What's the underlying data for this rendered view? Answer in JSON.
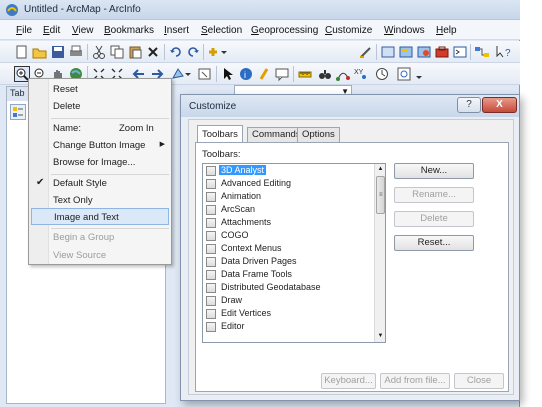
{
  "window": {
    "title": "Untitled - ArcMap - ArcInfo"
  },
  "menubar": {
    "items": [
      {
        "key": "F",
        "rest": "ile"
      },
      {
        "key": "E",
        "rest": "dit"
      },
      {
        "key": "V",
        "rest": "iew"
      },
      {
        "key": "B",
        "rest": "ookmarks"
      },
      {
        "key": "I",
        "rest": "nsert"
      },
      {
        "key": "S",
        "rest": "election"
      },
      {
        "key": "G",
        "rest": "eoprocessing"
      },
      {
        "key": "C",
        "rest": "ustomize"
      },
      {
        "key": "W",
        "rest": "indows"
      },
      {
        "key": "H",
        "rest": "elp"
      }
    ]
  },
  "toc": {
    "header": "Tab"
  },
  "context_menu": {
    "reset": "Reset",
    "delete": "Delete",
    "name_label": "Name:",
    "name_value": "Zoom In",
    "change_button_image": "Change Button Image",
    "browse_for_image": "Browse for Image...",
    "default_style": "Default Style",
    "text_only": "Text Only",
    "image_and_text": "Image and Text",
    "begin_a_group": "Begin a Group",
    "view_source": "View Source"
  },
  "dialog": {
    "title": "Customize",
    "help_glyph": "?",
    "close_glyph": "X",
    "tabs": [
      "Toolbars",
      "Commands",
      "Options"
    ],
    "toolbars_label": "Toolbars:",
    "toolbar_items": [
      "3D Analyst",
      "Advanced Editing",
      "Animation",
      "ArcScan",
      "Attachments",
      "COGO",
      "Context Menus",
      "Data Driven Pages",
      "Data Frame Tools",
      "Distributed Geodatabase",
      "Draw",
      "Edit Vertices",
      "Editor"
    ],
    "buttons": {
      "new": "New...",
      "rename": "Rename...",
      "delete": "Delete",
      "reset": "Reset...",
      "keyboard": "Keyboard...",
      "add_from_file": "Add from file...",
      "close": "Close"
    }
  }
}
